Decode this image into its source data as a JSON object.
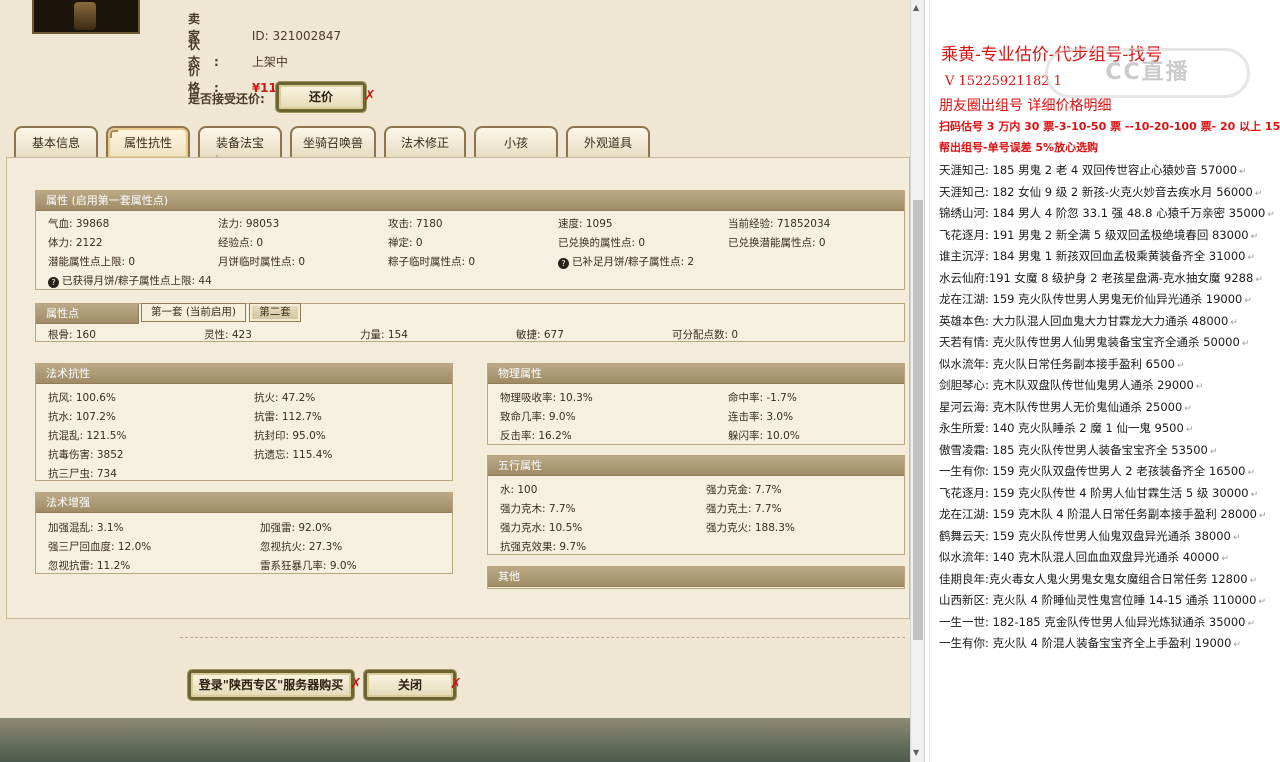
{
  "seller": {
    "seller_label": "卖 家",
    "id_text": "ID:  321002847",
    "status_label": "状 态:",
    "status_value": "上架中",
    "price_label": "价 格:",
    "price_value": "¥1100.00 (元)",
    "counter_label": "是否接受还价:",
    "counter_button": "还价"
  },
  "tabs": [
    "基本信息",
    "属性抗性",
    "装备法宝",
    "坐骑召唤兽",
    "法术修正",
    "小孩",
    "外观道具"
  ],
  "attributes": {
    "title": "属性 (启用第一套属性点)",
    "row1": [
      "气血: 39868",
      "法力: 98053",
      "攻击: 7180",
      "速度: 1095",
      "当前经验: 71852034"
    ],
    "row2": [
      "体力: 2122",
      "经验点: 0",
      "禅定: 0",
      "已兑换的属性点: 0",
      "已兑换潜能属性点: 0"
    ],
    "row3": [
      "潜能属性点上限: 0",
      "月饼临时属性点: 0",
      "粽子临时属性点: 0",
      "已补足月饼/粽子属性点: 2"
    ],
    "row4": "已获得月饼/粽子属性点上限: 44"
  },
  "attr_points": {
    "title": "属性点",
    "tab1": "第一套 (当前启用)",
    "tab2": "第二套",
    "values": [
      "根骨: 160",
      "灵性: 423",
      "力量: 154",
      "敏捷: 677",
      "可分配点数: 0"
    ]
  },
  "spell_resist": {
    "title": "法术抗性",
    "left": [
      "抗风: 100.6%",
      "抗水: 107.2%",
      "抗混乱: 121.5%",
      "抗毒伤害: 3852",
      "抗三尸虫: 734"
    ],
    "right": [
      "抗火: 47.2%",
      "抗雷: 112.7%",
      "抗封印: 95.0%",
      "抗遗忘: 115.4%"
    ]
  },
  "spell_boost": {
    "title": "法术增强",
    "left": [
      "加强混乱: 3.1%",
      "强三尸回血度: 12.0%",
      "忽视抗雷: 11.2%"
    ],
    "right": [
      "加强雷: 92.0%",
      "忽视抗火: 27.3%",
      "雷系狂暴几率: 9.0%"
    ]
  },
  "physical": {
    "title": "物理属性",
    "left": [
      "物理吸收率: 10.3%",
      "致命几率: 9.0%",
      "反击率: 16.2%"
    ],
    "right": [
      "命中率: -1.7%",
      "连击率: 3.0%",
      "躲闪率: 10.0%"
    ]
  },
  "elements": {
    "title": "五行属性",
    "left": [
      "水: 100",
      "强力克木: 7.7%",
      "强力克水: 10.5%",
      "抗强克效果: 9.7%"
    ],
    "right": [
      "强力克金: 7.7%",
      "强力克土: 7.7%",
      "强力克火: 188.3%"
    ]
  },
  "other": {
    "title": "其他"
  },
  "footer": {
    "login_button": "登录\"陕西专区\"服务器购买",
    "close_button": "关闭"
  },
  "doc": {
    "title": "乘黄-专业估价-代步组号-找号",
    "phone": "V 15225921182    1",
    "subtitle": "朋友圈出组号    详细价格明细",
    "price_rule": "扫码估号 3 万内 30 票-3-10-50 票 --10-20-100 票- 20 以上 150",
    "note": "帮出组号-单号误差 5%放心选购",
    "watermark": "CC直播",
    "lines": [
      "天涯知己: 185 男鬼 2 老 4 双回传世容止心猿妙音 57000",
      "天涯知己: 182 女仙 9 级 2 新孩-火克火妙音去疾水月 56000",
      "锦绣山河: 184 男人 4 阶忽 33.1 强 48.8 心猿千万亲密 35000",
      "飞花逐月: 191 男鬼 2 新全满 5 级双回孟极绝境春回 83000",
      "谁主沉浮: 184 男鬼 1 新孩双回血孟极乘黄装备齐全 31000",
      "水云仙府:191 女魔 8 级护身 2 老孩星盘满-克水抽女魔 9288",
      "龙在江湖: 159 克火队传世男人男鬼无价仙异光通杀 19000",
      "英雄本色: 大力队混人回血鬼大力甘霖龙大力通杀 48000",
      "天若有情: 克火队传世男人仙男鬼装备宝宝齐全通杀 50000",
      "似水流年: 克火队日常任务副本接手盈利 6500",
      "剑胆琴心: 克木队双盘队传世仙鬼男人通杀 29000",
      "星河云海: 克木队传世男人无价鬼仙通杀 25000",
      "永生所爱: 140 克火队睡杀 2 魔 1 仙一鬼 9500",
      "傲雪凌霜: 185 克火队传世男人装备宝宝齐全 53500",
      "一生有你: 159 克火队双盘传世男人 2 老孩装备齐全 16500",
      "飞花逐月: 159 克火队传世 4 阶男人仙甘霖生活 5 级 30000",
      "龙在江湖: 159 克木队 4 阶混人日常任务副本接手盈利 28000",
      "鹤舞云天: 159 克火队传世男人仙鬼双盘异光通杀 38000",
      "似水流年: 140 克木队混人回血血双盘异光通杀 40000",
      "佳期良年:克火毒女人鬼火男鬼女鬼女魔组合日常任务 12800",
      "山西新区: 克火队 4 阶睡仙灵性鬼宫位睡 14-15 通杀 110000",
      "一生一世: 182-185 克金队传世男人仙异光炼狱通杀 35000",
      "一生有你: 克火队 4 阶混人装备宝宝齐全上手盈利 19000"
    ]
  }
}
